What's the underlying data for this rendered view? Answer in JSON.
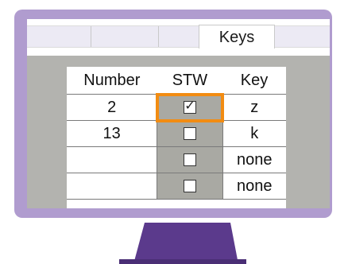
{
  "tabs": [
    {
      "label": ""
    },
    {
      "label": ""
    },
    {
      "label": ""
    },
    {
      "label": "Keys",
      "active": true
    }
  ],
  "table": {
    "headers": {
      "number": "Number",
      "stw": "STW",
      "key": "Key"
    },
    "rows": [
      {
        "number": "2",
        "stw_checked": true,
        "key": "z",
        "highlighted": true
      },
      {
        "number": "13",
        "stw_checked": false,
        "key": "k"
      },
      {
        "number": "",
        "stw_checked": false,
        "key": "none"
      },
      {
        "number": "",
        "stw_checked": false,
        "key": "none"
      }
    ]
  },
  "colors": {
    "monitor_frame": "#b09ccf",
    "stand": "#5b3a8c",
    "panel_bg": "#b3b3af",
    "stw_column_bg": "#a9a9a3",
    "highlight": "#f28c12",
    "tabbar_bg": "#eceaf4"
  },
  "icons": {
    "checked": "checkbox-checked-icon",
    "unchecked": "checkbox-unchecked-icon"
  }
}
